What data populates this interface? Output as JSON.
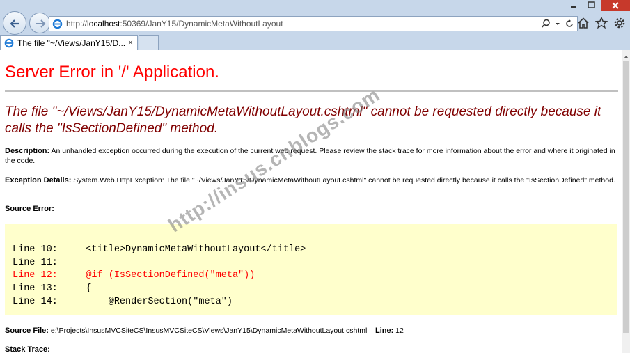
{
  "browser": {
    "url_prefix": "http://",
    "url_host": "localhost",
    "url_rest": ":50369/JanY15/DynamicMetaWithoutLayout",
    "tab_title": "The file \"~/Views/JanY15/D...",
    "tab_close": "×",
    "accent": "#c7d7ea"
  },
  "page": {
    "title": "Server Error in '/' Application.",
    "error_message": "The file \"~/Views/JanY15/DynamicMetaWithoutLayout.cshtml\" cannot be requested directly because it calls the \"IsSectionDefined\" method.",
    "description_label": "Description:",
    "description_text": " An unhandled exception occurred during the execution of the current web request. Please review the stack trace for more information about the error and where it originated in the code.",
    "exception_label": "Exception Details:",
    "exception_text": " System.Web.HttpException: The file \"~/Views/JanY15/DynamicMetaWithoutLayout.cshtml\" cannot be requested directly because it calls the \"IsSectionDefined\" method.",
    "source_error_label": "Source Error:",
    "code_lines": [
      "Line 10:     <title>DynamicMetaWithoutLayout</title>",
      "Line 11:",
      "Line 12:     @if (IsSectionDefined(\"meta\"))",
      "Line 13:     {",
      "Line 14:         @RenderSection(\"meta\")"
    ],
    "source_file_label": "Source File:",
    "source_file_path": " e:\\Projects\\InsusMVCSiteCS\\InsusMVCSiteCS\\Views\\JanY15\\DynamicMetaWithoutLayout.cshtml",
    "line_label": "Line:",
    "line_number": " 12",
    "stack_trace_label": "Stack Trace:",
    "watermark": "http://insus.cnblogs.com",
    "colors": {
      "title": "#ff0000",
      "message": "#800000",
      "code_bg": "#ffffcc",
      "error_line": "#ff0000"
    }
  }
}
